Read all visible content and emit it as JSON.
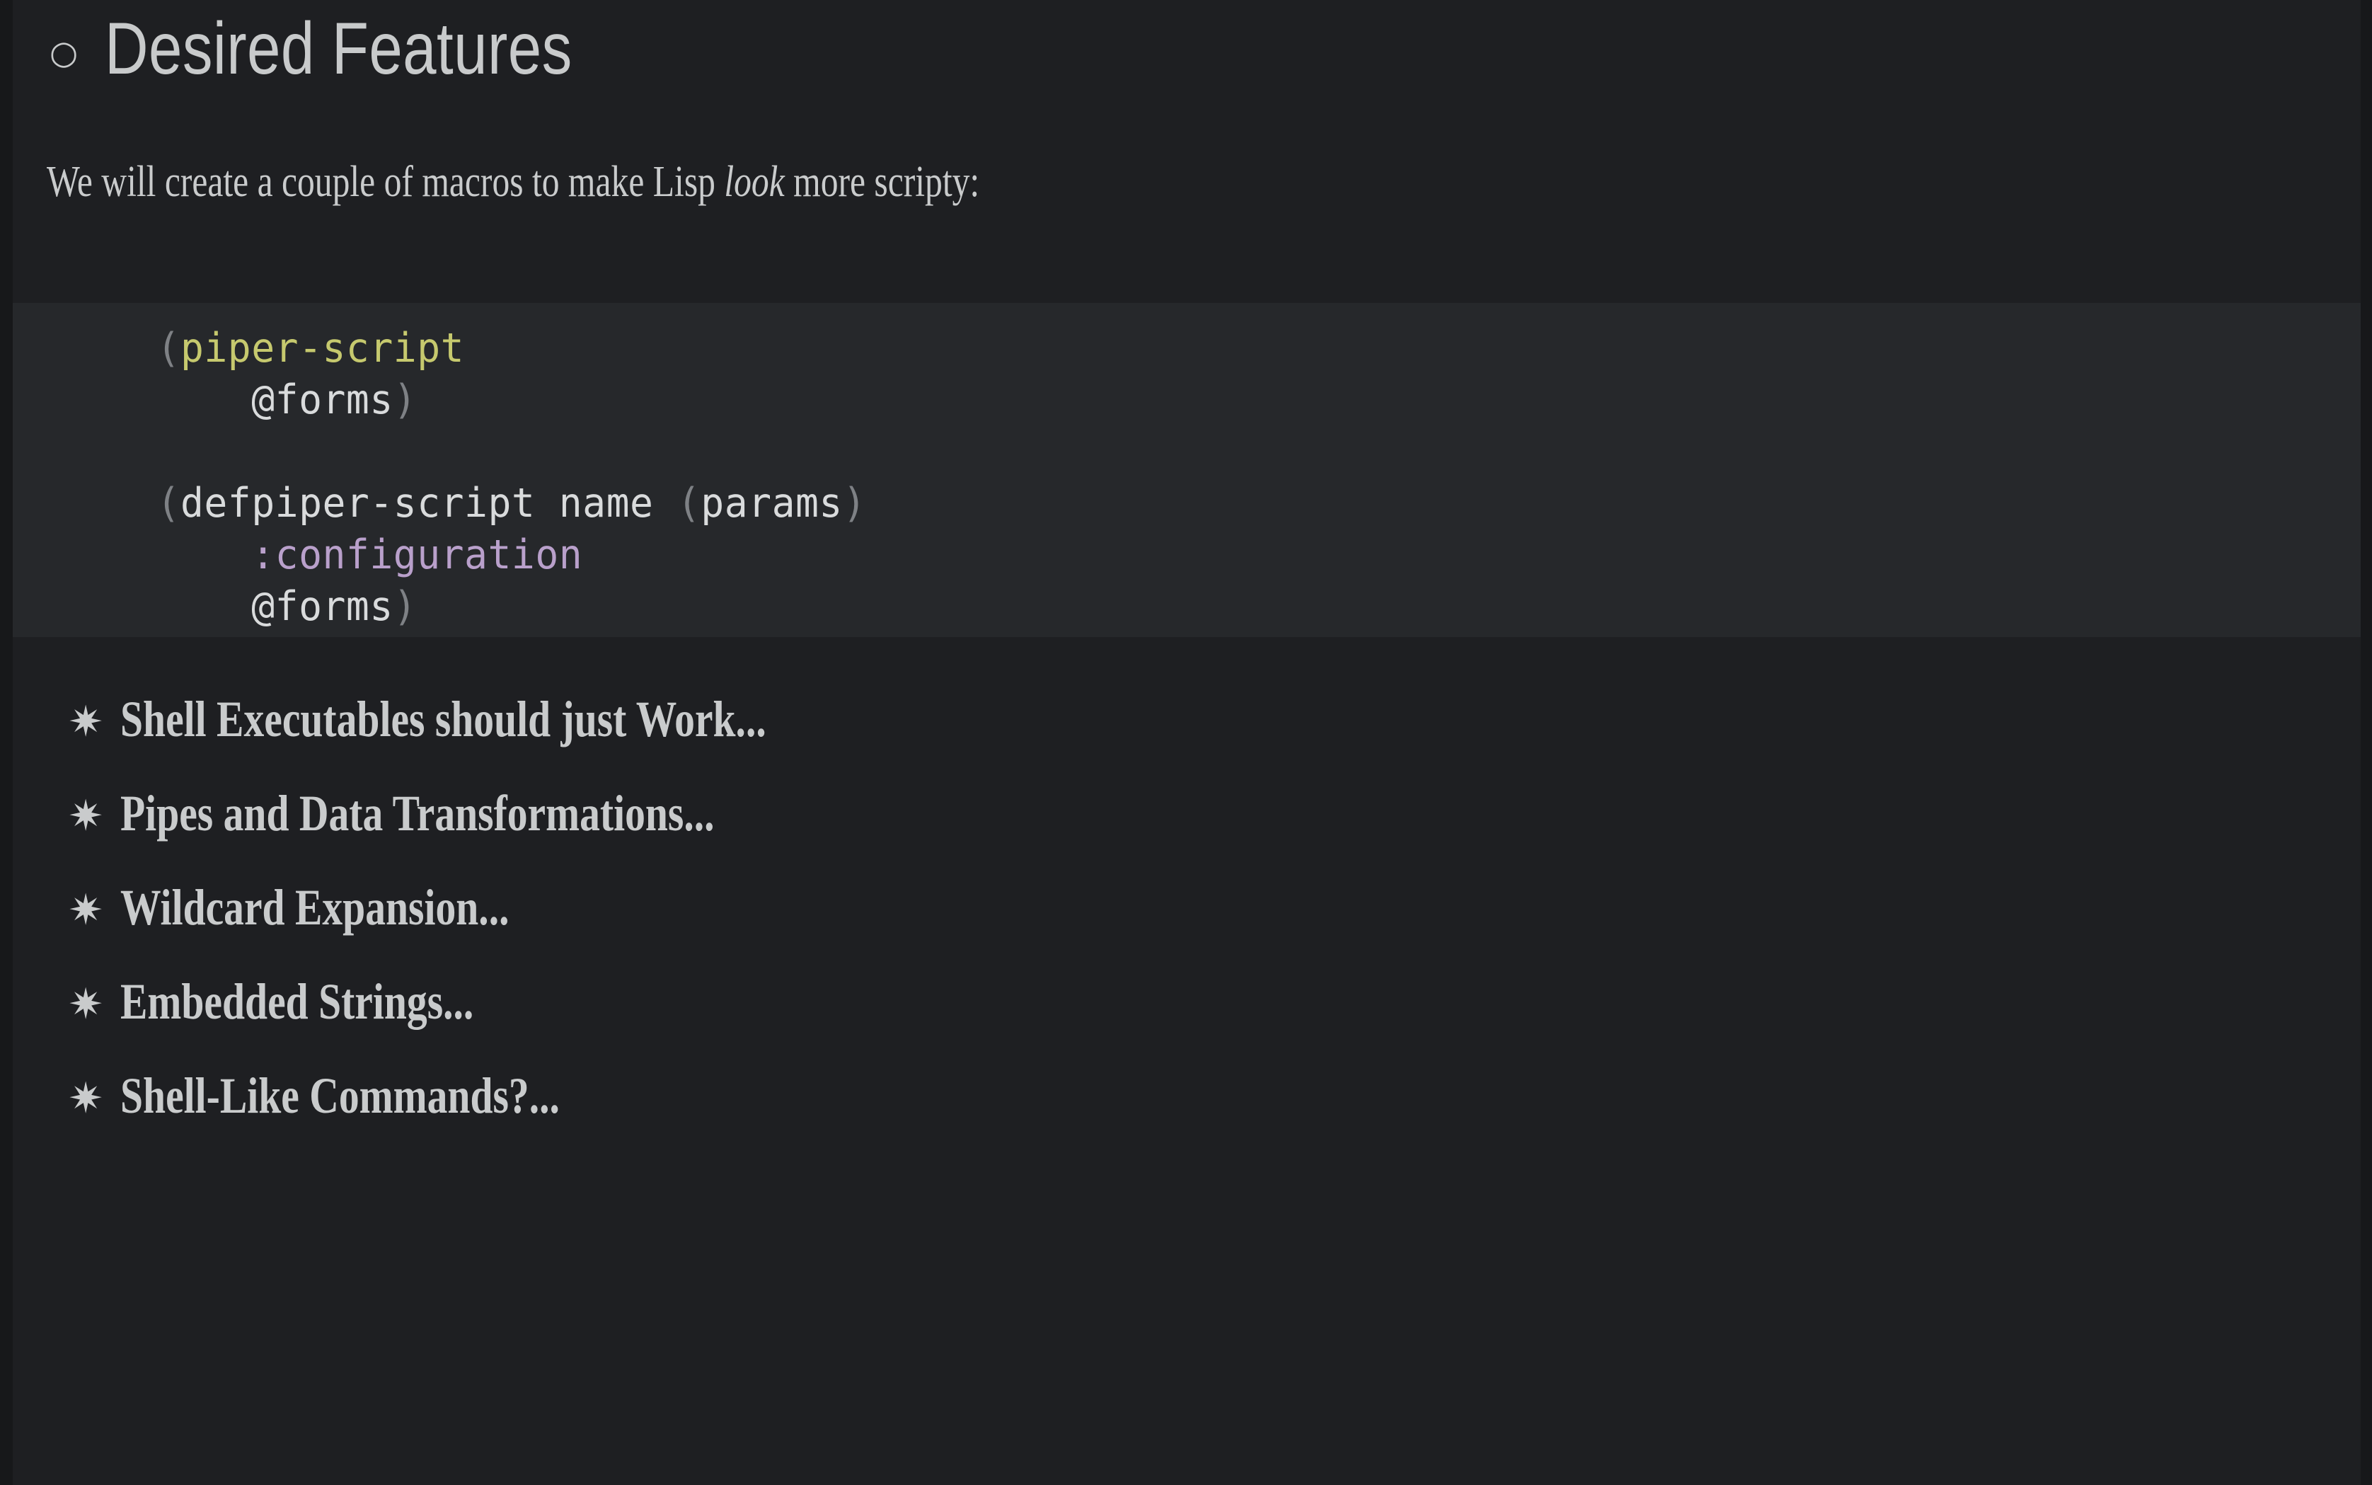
{
  "slide": {
    "background_color": "#1e1f22",
    "edge_strip_color": "#17181a",
    "text_color": "#c9cbcc"
  },
  "heading": {
    "bullet": "○",
    "bullet_icon_name": "ring-bullet-icon",
    "title": "Desired Features"
  },
  "lead": {
    "before_italic": "We will create a couple of macros to make Lisp ",
    "italic": "look",
    "after_italic": " more scripty:"
  },
  "code_block": {
    "background_color": "#26282b",
    "language": "lisp",
    "colors": {
      "macro_name": "#c6c96e",
      "keyword": "#b9a0cb",
      "paren": "#7e8185",
      "plain": "#d9dbdc"
    },
    "lines": [
      {
        "indent": 0,
        "tokens": [
          {
            "text": "(",
            "kind": "paren"
          },
          {
            "text": "piper-script",
            "kind": "macro"
          }
        ]
      },
      {
        "indent": 4,
        "tokens": [
          {
            "text": "@forms",
            "kind": "plain"
          },
          {
            "text": ")",
            "kind": "paren"
          }
        ]
      },
      {
        "indent": 0,
        "tokens": []
      },
      {
        "indent": 0,
        "tokens": [
          {
            "text": "(",
            "kind": "paren"
          },
          {
            "text": "defpiper-script name ",
            "kind": "plain"
          },
          {
            "text": "(",
            "kind": "paren"
          },
          {
            "text": "params",
            "kind": "plain"
          },
          {
            "text": ")",
            "kind": "paren"
          }
        ]
      },
      {
        "indent": 4,
        "tokens": [
          {
            "text": ":configuration",
            "kind": "kw"
          }
        ]
      },
      {
        "indent": 4,
        "tokens": [
          {
            "text": "@forms",
            "kind": "plain"
          },
          {
            "text": ")",
            "kind": "paren"
          }
        ]
      }
    ],
    "plain_text": "(piper-script\n    @forms)\n\n(defpiper-script name (params)\n    :configuration\n    @forms)"
  },
  "features": {
    "bullet": "✷",
    "bullet_icon_name": "eight-point-star-bullet-icon",
    "items": [
      {
        "label": "Shell Executables should just Work..."
      },
      {
        "label": "Pipes and Data Transformations..."
      },
      {
        "label": "Wildcard Expansion..."
      },
      {
        "label": "Embedded Strings..."
      },
      {
        "label": "Shell-Like Commands?..."
      }
    ]
  }
}
